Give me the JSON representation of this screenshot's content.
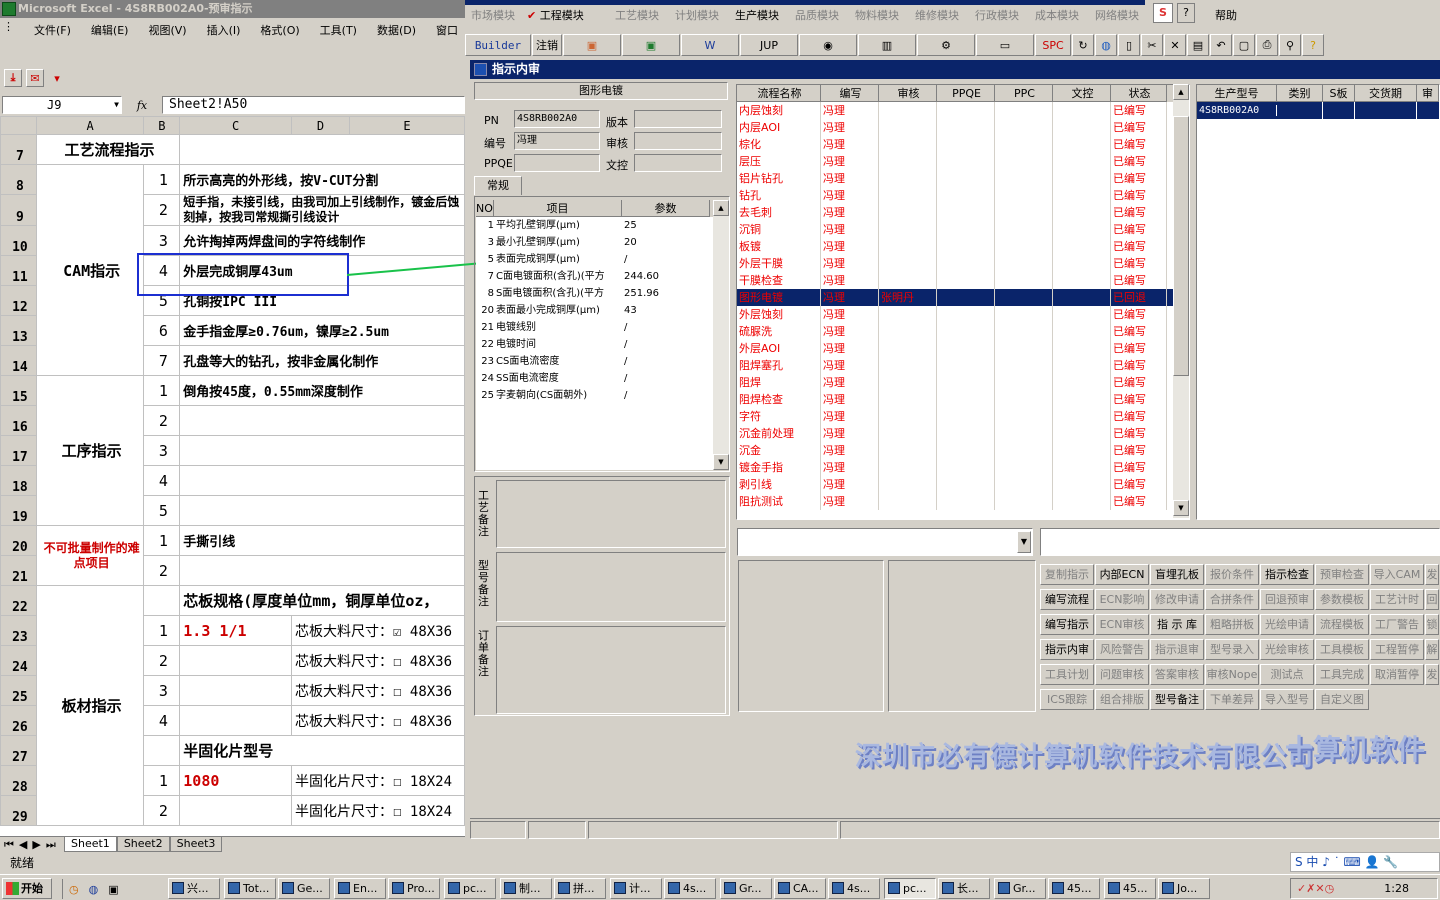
{
  "excel": {
    "title": "Microsoft Excel - 4S8RB002A0-预审指示",
    "menu": [
      "文件(F)",
      "编辑(E)",
      "视图(V)",
      "插入(I)",
      "格式(O)",
      "工具(T)",
      "数据(D)",
      "窗口"
    ],
    "name_box": "J9",
    "fx": "fx",
    "formula": "Sheet2!A50",
    "col_headers": [
      "A",
      "B",
      "C",
      "D",
      "E"
    ],
    "rows": {
      "r7": {
        "num": "7",
        "a": "工艺流程指示"
      },
      "r8": {
        "num": "8",
        "b": "1",
        "c": "所示高亮的外形线，按V-CUT分割"
      },
      "r9": {
        "num": "9",
        "b": "2",
        "c": "短手指，未接引线，由我司加上引线制作，镀金后蚀刻掉，按我司常规撕引线设计"
      },
      "r10": {
        "num": "10",
        "b": "3",
        "c": "允许掏掉两焊盘间的字符线制作"
      },
      "r11": {
        "num": "11",
        "b": "4",
        "c": "外层完成铜厚43um",
        "a": "CAM指示"
      },
      "r12": {
        "num": "12",
        "b": "5",
        "c": "孔铜按IPC III"
      },
      "r13": {
        "num": "13",
        "b": "6",
        "c": "金手指金厚≥0.76um，镍厚≥2.5um"
      },
      "r14": {
        "num": "14",
        "b": "7",
        "c": "孔盘等大的钻孔，按非金属化制作"
      },
      "r15": {
        "num": "15",
        "b": "1",
        "c": "倒角按45度，0.55mm深度制作"
      },
      "r16": {
        "num": "16",
        "b": "2"
      },
      "r17": {
        "num": "17",
        "b": "3",
        "a": "工序指示"
      },
      "r18": {
        "num": "18",
        "b": "4"
      },
      "r19": {
        "num": "19",
        "b": "5"
      },
      "r20": {
        "num": "20",
        "b": "1",
        "c": "手撕引线",
        "a": "不可批量制作的难点项目"
      },
      "r21": {
        "num": "21",
        "b": "2"
      },
      "r22": {
        "num": "22",
        "c": "芯板规格(厚度单位mm，铜厚单位oz，"
      },
      "r23": {
        "num": "23",
        "b": "1",
        "c": "1.3 1/1",
        "d": "芯板大料尺寸：",
        "e": "☑ 48X36"
      },
      "r24": {
        "num": "24",
        "b": "2",
        "d": "芯板大料尺寸：",
        "e": "☐ 48X36"
      },
      "r25": {
        "num": "25",
        "b": "3",
        "d": "芯板大料尺寸：",
        "e": "☐ 48X36"
      },
      "r26": {
        "num": "26",
        "b": "4",
        "d": "芯板大料尺寸：",
        "e": "☐ 48X36",
        "a": "板材指示"
      },
      "r27": {
        "num": "27",
        "c": "半固化片型号"
      },
      "r28": {
        "num": "28",
        "b": "1",
        "c": "1080",
        "d": "半固化片尺寸：",
        "e": "☐ 18X24"
      },
      "r29": {
        "num": "29",
        "b": "2",
        "d": "半固化片尺寸：",
        "e": "☐ 18X24"
      }
    },
    "sheet_tabs": [
      "Sheet1",
      "Sheet2",
      "Sheet3"
    ],
    "status": "就绪"
  },
  "app": {
    "menu": [
      "市场模块",
      "工程模块",
      "工艺模块",
      "计划模块",
      "生产模块",
      "品质模块",
      "物料模块",
      "维修模块",
      "行政模块",
      "成本模块",
      "网络模块",
      "帮助"
    ],
    "toolbar": [
      "Builder",
      "注销",
      "JUP",
      "SPC"
    ],
    "window_title": "指示内审",
    "section_title": "图形电镀",
    "fields": {
      "pn_label": "PN",
      "pn": "4S8RB002A0",
      "version_label": "版本",
      "editor_label": "编号",
      "editor": "冯理",
      "review_label": "审核",
      "ppqe_label": "PPQE",
      "final_label": "文控"
    },
    "tab": "常规",
    "param_headers": [
      "NO",
      "项目",
      "参数"
    ],
    "params": [
      [
        "1",
        "平均孔壁铜厚(μm)",
        "25"
      ],
      [
        "3",
        "最小孔壁铜厚(μm)",
        "20"
      ],
      [
        "5",
        "表面完成铜厚(μm)",
        "/"
      ],
      [
        "7",
        "C面电镀面积(含孔)(平方",
        "244.60"
      ],
      [
        "8",
        "S面电镀面积(含孔)(平方",
        "251.96"
      ],
      [
        "20",
        "表面最小完成铜厚(μm)",
        "43"
      ],
      [
        "21",
        "电镀线别",
        "/"
      ],
      [
        "22",
        "电镀时间",
        "/"
      ],
      [
        "23",
        "CS面电流密度",
        "/"
      ],
      [
        "24",
        "SS面电流密度",
        "/"
      ],
      [
        "25",
        "字麦朝向(CS面朝外)",
        "/"
      ]
    ],
    "note_labels": [
      "工艺备注",
      "型号备注",
      "订单备注"
    ],
    "proc_headers": [
      "流程名称",
      "编写",
      "审核",
      "PPQE",
      "PPC",
      "文控",
      "状态"
    ],
    "procs": [
      [
        "内层蚀刻",
        "冯理",
        "",
        "已编写"
      ],
      [
        "内层AOI",
        "冯理",
        "",
        "已编写"
      ],
      [
        "棕化",
        "冯理",
        "",
        "已编写"
      ],
      [
        "层压",
        "冯理",
        "",
        "已编写"
      ],
      [
        "铝片钻孔",
        "冯理",
        "",
        "已编写"
      ],
      [
        "钻孔",
        "冯理",
        "",
        "已编写"
      ],
      [
        "去毛刺",
        "冯理",
        "",
        "已编写"
      ],
      [
        "沉铜",
        "冯理",
        "",
        "已编写"
      ],
      [
        "板镀",
        "冯理",
        "",
        "已编写"
      ],
      [
        "外层干膜",
        "冯理",
        "",
        "已编写"
      ],
      [
        "干膜检查",
        "冯理",
        "",
        "已编写"
      ],
      [
        "图形电镀",
        "冯理",
        "张明丹",
        "已回退"
      ],
      [
        "外层蚀刻",
        "冯理",
        "",
        "已编写"
      ],
      [
        "硫脲洗",
        "冯理",
        "",
        "已编写"
      ],
      [
        "外层AOI",
        "冯理",
        "",
        "已编写"
      ],
      [
        "阻焊塞孔",
        "冯理",
        "",
        "已编写"
      ],
      [
        "阻焊",
        "冯理",
        "",
        "已编写"
      ],
      [
        "阻焊检查",
        "冯理",
        "",
        "已编写"
      ],
      [
        "字符",
        "冯理",
        "",
        "已编写"
      ],
      [
        "沉金前处理",
        "冯理",
        "",
        "已编写"
      ],
      [
        "沉金",
        "冯理",
        "",
        "已编写"
      ],
      [
        "镀金手指",
        "冯理",
        "",
        "已编写"
      ],
      [
        "剥引线",
        "冯理",
        "",
        "已编写"
      ],
      [
        "阻抗测试",
        "冯理",
        "",
        "已编写"
      ]
    ],
    "model_headers": [
      "生产型号",
      "类别",
      "S板",
      "交货期",
      "审"
    ],
    "model_row": "4S8RB002A0",
    "buttons": [
      [
        "复制指示",
        "内部ECN",
        "盲埋孔板",
        "报价条件",
        "指示检查",
        "预审检查",
        "导入CAM",
        "发"
      ],
      [
        "编写流程",
        "ECN影响",
        "修改申请",
        "合拼条件",
        "回退预审",
        "参数模板",
        "工艺计时",
        "回"
      ],
      [
        "编写指示",
        "ECN审核",
        "指 示 库",
        "粗略拼板",
        "光绘申请",
        "流程模板",
        "工厂警告",
        "锁"
      ],
      [
        "指示内审",
        "风险警告",
        "指示退审",
        "型号录入",
        "光绘审核",
        "工具模板",
        "工程暂停",
        "解"
      ],
      [
        "工具计划",
        "问题审核",
        "答案审核",
        "审核Nope",
        "测试点",
        "工具完成",
        "取消暂停",
        "发"
      ],
      [
        "ICS跟踪",
        "组合排版",
        "型号备注",
        "下单差异",
        "导入型号",
        "自定义图",
        "",
        ""
      ]
    ],
    "enabled_buttons": [
      "内部ECN",
      "盲埋孔板",
      "指示检查",
      "编写流程",
      "编写指示",
      "指 示 库",
      "指示内审",
      "型号备注"
    ],
    "company": "深圳市必有德计算机软件技术有限公司",
    "company2": "十算机软件"
  },
  "taskbar": {
    "start": "开始",
    "tasks": [
      "兴...",
      "Tot...",
      "Ge...",
      "En...",
      "Pro...",
      "pc...",
      "制...",
      "拼...",
      "计...",
      "4s...",
      "Gr...",
      "CA...",
      "4s...",
      "pc...",
      "长...",
      "Gr...",
      "45...",
      "45...",
      "Jo..."
    ],
    "clock": "1:28",
    "ime": "S 中 ♪ ˙ ⌨ 👤 🔧"
  }
}
